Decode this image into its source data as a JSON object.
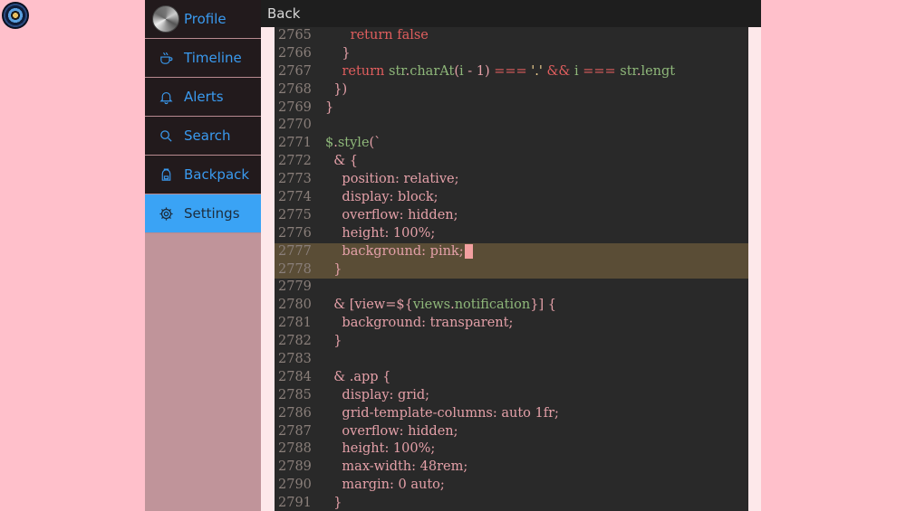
{
  "nav": {
    "items": [
      {
        "label": "Profile",
        "icon": "avatar"
      },
      {
        "label": "Timeline",
        "icon": "coffee-icon"
      },
      {
        "label": "Alerts",
        "icon": "bell-icon"
      },
      {
        "label": "Search",
        "icon": "search-icon"
      },
      {
        "label": "Backpack",
        "icon": "backpack-icon"
      },
      {
        "label": "Settings",
        "icon": "gear-icon"
      }
    ],
    "active": "Settings"
  },
  "header": {
    "back_label": "Back"
  },
  "editor": {
    "cursor_line": "2777",
    "lines": [
      {
        "n": "2765",
        "t": "      return false"
      },
      {
        "n": "2766",
        "t": "    }"
      },
      {
        "n": "2767",
        "t": "    return str.charAt(i - 1) === '.' && i === str.lengt"
      },
      {
        "n": "2768",
        "t": "  })"
      },
      {
        "n": "2769",
        "t": "}"
      },
      {
        "n": "2770",
        "t": ""
      },
      {
        "n": "2771",
        "t": "$.style(`"
      },
      {
        "n": "2772",
        "t": "  & {"
      },
      {
        "n": "2773",
        "t": "    position: relative;"
      },
      {
        "n": "2774",
        "t": "    display: block;"
      },
      {
        "n": "2775",
        "t": "    overflow: hidden;"
      },
      {
        "n": "2776",
        "t": "    height: 100%;"
      },
      {
        "n": "2777",
        "t": "    background: pink;"
      },
      {
        "n": "2778",
        "t": "  }"
      },
      {
        "n": "2779",
        "t": ""
      },
      {
        "n": "2780",
        "t": "  & [view=${views.notification}] {"
      },
      {
        "n": "2781",
        "t": "    background: transparent;"
      },
      {
        "n": "2782",
        "t": "  }"
      },
      {
        "n": "2783",
        "t": ""
      },
      {
        "n": "2784",
        "t": "  & .app {"
      },
      {
        "n": "2785",
        "t": "    display: grid;"
      },
      {
        "n": "2786",
        "t": "    grid-template-columns: auto 1fr;"
      },
      {
        "n": "2787",
        "t": "    overflow: hidden;"
      },
      {
        "n": "2788",
        "t": "    height: 100%;"
      },
      {
        "n": "2789",
        "t": "    max-width: 48rem;"
      },
      {
        "n": "2790",
        "t": "    margin: 0 auto;"
      },
      {
        "n": "2791",
        "t": "  }"
      }
    ]
  },
  "colors": {
    "page_bg": "#ffc0cb",
    "nav_bg": "#221a1c",
    "nav_active_bg": "#3aa3f5",
    "nav_text": "#3a9aef",
    "editor_bg": "#292929",
    "highlight_bg": "#5a4d36"
  }
}
